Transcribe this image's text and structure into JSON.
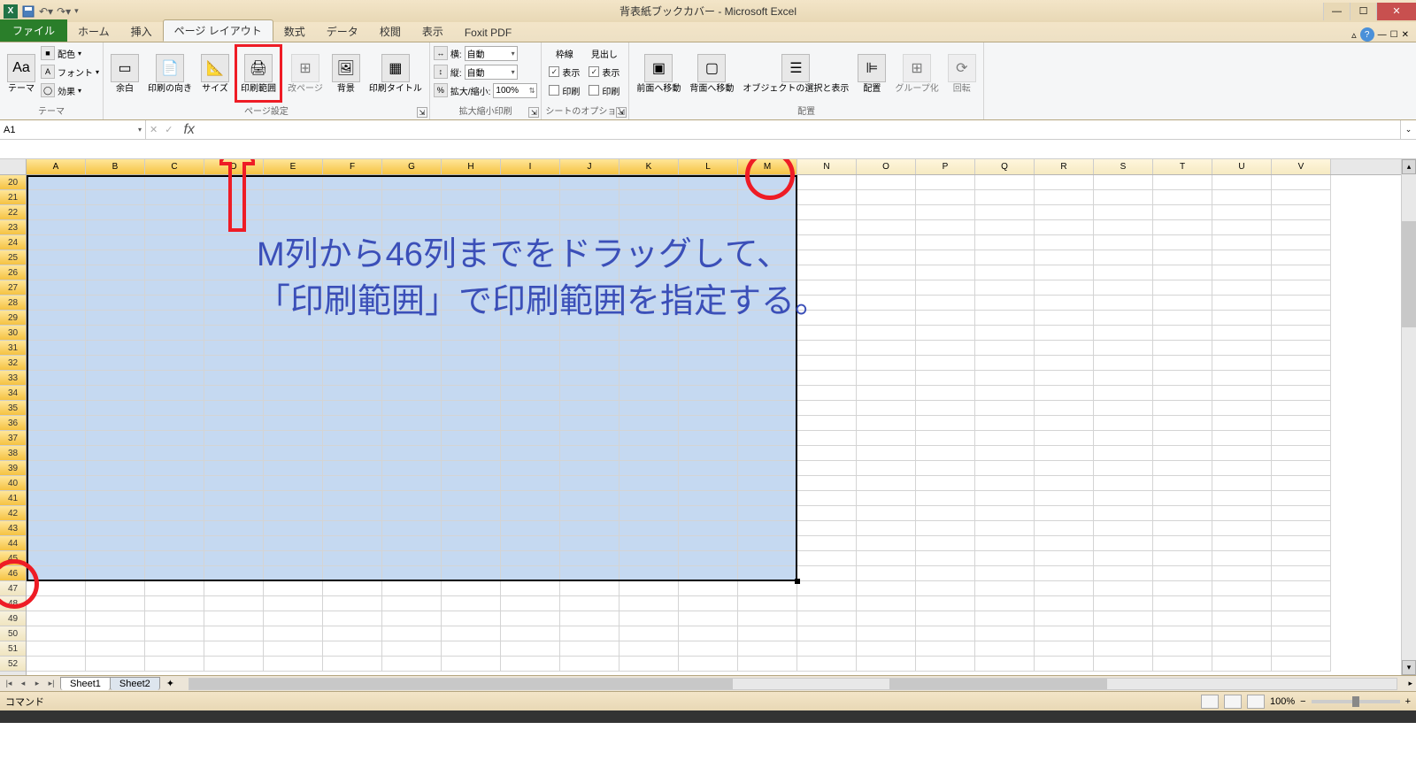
{
  "window": {
    "title": "背表紙ブックカバー - Microsoft Excel",
    "min": "—",
    "max": "☐",
    "close": "✕"
  },
  "tabs": {
    "file": "ファイル",
    "home": "ホーム",
    "insert": "挿入",
    "pagelayout": "ページ レイアウト",
    "formulas": "数式",
    "data": "データ",
    "review": "校閲",
    "view": "表示",
    "foxit": "Foxit PDF"
  },
  "ribbon": {
    "themes": {
      "theme": "テーマ",
      "colors": "配色",
      "fonts": "フォント",
      "effects": "効果",
      "group": "テーマ"
    },
    "pagesetup": {
      "margins": "余白",
      "orientation": "印刷の向き",
      "size": "サイズ",
      "printarea": "印刷範囲",
      "breaks": "改ページ",
      "background": "背景",
      "printtitles": "印刷タイトル",
      "group": "ページ設定"
    },
    "scale": {
      "width_lbl": "横:",
      "width_val": "自動",
      "height_lbl": "縦:",
      "height_val": "自動",
      "scale_lbl": "拡大/縮小:",
      "scale_val": "100%",
      "group": "拡大縮小印刷"
    },
    "sheetopts": {
      "gridlines": "枠線",
      "headings": "見出し",
      "view": "表示",
      "print": "印刷",
      "group": "シートのオプション"
    },
    "arrange": {
      "front": "前面へ移動",
      "back": "背面へ移動",
      "select": "オブジェクトの選択と表示",
      "align": "配置",
      "group_btn": "グループ化",
      "rotate": "回転",
      "group": "配置"
    }
  },
  "namebox": "A1",
  "columns": [
    "A",
    "B",
    "C",
    "D",
    "E",
    "F",
    "G",
    "H",
    "I",
    "J",
    "K",
    "L",
    "M",
    "N",
    "O",
    "P",
    "Q",
    "R",
    "S",
    "T",
    "U",
    "V"
  ],
  "rows_start": 20,
  "rows_end": 52,
  "selected_cols_end": "M",
  "selected_col_idx": 13,
  "annotation": {
    "line1": "M列から46列までをドラッグして、",
    "line2": "「印刷範囲」で印刷範囲を指定する。"
  },
  "sheets": {
    "s1": "Sheet1",
    "s2": "Sheet2"
  },
  "status": {
    "left": "コマンド",
    "zoom": "100%",
    "minus": "−",
    "plus": "+"
  }
}
